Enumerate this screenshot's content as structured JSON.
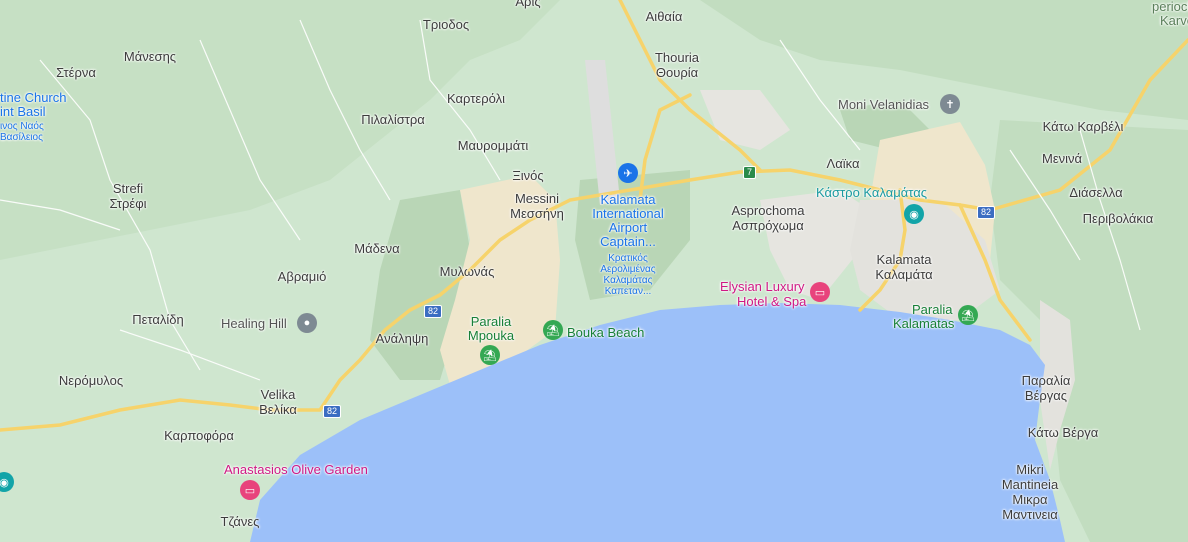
{
  "map": {
    "places": [
      {
        "id": "aris",
        "text": "Αρις"
      },
      {
        "id": "aithaia",
        "text": "Αιθαία"
      },
      {
        "id": "triodos",
        "text": "Τριοδος"
      },
      {
        "id": "sterna",
        "text": "Στέρνα"
      },
      {
        "id": "manesis",
        "text": "Μάνεσης"
      },
      {
        "id": "thouria_en",
        "text": "Thouria"
      },
      {
        "id": "thouria_gr",
        "text": "Θουρία"
      },
      {
        "id": "karterоli",
        "text": "Καρτερόλι"
      },
      {
        "id": "pilalistra",
        "text": "Πιλαλίστρα"
      },
      {
        "id": "mavrommati",
        "text": "Μαυρομμάτι"
      },
      {
        "id": "xinos",
        "text": "Ξινός"
      },
      {
        "id": "messini_en",
        "text": "Messini"
      },
      {
        "id": "messini_gr",
        "text": "Μεσσήνη"
      },
      {
        "id": "strefi_en",
        "text": "Strefi"
      },
      {
        "id": "strefi_gr",
        "text": "Στρέφι"
      },
      {
        "id": "madena",
        "text": "Μάδενα"
      },
      {
        "id": "avramio",
        "text": "Αβραμιό"
      },
      {
        "id": "mylonas",
        "text": "Μυλωνάς"
      },
      {
        "id": "petalidi",
        "text": "Πεταλίδη"
      },
      {
        "id": "analipsi",
        "text": "Ανάληψη"
      },
      {
        "id": "neromylos",
        "text": "Νερόμυλος"
      },
      {
        "id": "velika_en",
        "text": "Velika"
      },
      {
        "id": "velika_gr",
        "text": "Βελίκα"
      },
      {
        "id": "karpofora",
        "text": "Καρποφόρα"
      },
      {
        "id": "tzanes",
        "text": "Τζάνες"
      },
      {
        "id": "aspro_en",
        "text": "Asprochoma"
      },
      {
        "id": "aspro_gr",
        "text": "Ασπρόχωμα"
      },
      {
        "id": "laika",
        "text": "Λαϊκα"
      },
      {
        "id": "kalamata_en",
        "text": "Kalamata"
      },
      {
        "id": "kalamata_gr",
        "text": "Καλαμάτα"
      },
      {
        "id": "kato_karveli",
        "text": "Κάτω Καρβέλι"
      },
      {
        "id": "menina",
        "text": "Μενινά"
      },
      {
        "id": "diasella",
        "text": "Διάσελλα"
      },
      {
        "id": "perivolakia",
        "text": "Περιβολάκια"
      },
      {
        "id": "paralia_vergas_1",
        "text": "Παραλία"
      },
      {
        "id": "paralia_vergas_2",
        "text": "Βέργας"
      },
      {
        "id": "kato_verga",
        "text": "Κάτω Βέργα"
      },
      {
        "id": "mikri_1",
        "text": "Mikri"
      },
      {
        "id": "mikri_2",
        "text": "Mantineia"
      },
      {
        "id": "mikri_3",
        "text": "Μικρα"
      },
      {
        "id": "mikri_4",
        "text": "Μαντινεια"
      },
      {
        "id": "perioch",
        "text": "periochi"
      },
      {
        "id": "karve",
        "text": "Karve"
      }
    ],
    "pois": {
      "church_1": "tine Church",
      "church_2": "int Basil",
      "church_3": "ινος Ναός",
      "church_4": "Βασίλειος",
      "airport_1": "Kalamata",
      "airport_2": "International",
      "airport_3": "Airport",
      "airport_4": "Captain...",
      "airport_gr_1": "Κρατικός",
      "airport_gr_2": "Αερολιμένας",
      "airport_gr_3": "Καλαμάτας",
      "airport_gr_4": "Καπεταν...",
      "moni": "Moni Velanidias",
      "kastro": "Κάστρο Καλαμάτας",
      "elysian_1": "Elysian Luxury",
      "elysian_2": "Hotel & Spa",
      "paralia_kal_1": "Paralia",
      "paralia_kal_2": "Kalamatas",
      "paralia_mp_1": "Paralia",
      "paralia_mp_2": "Μpouka",
      "bouka": "Bouka Beach",
      "healing": "Healing Hill",
      "olive": "Anastasios Olive Garden"
    },
    "shields": {
      "r82a": "82",
      "r82b": "82",
      "r82c": "82",
      "r7": "7"
    },
    "colors": {
      "land": "#cfe6cf",
      "sea": "#9cc0f9",
      "urban": "#e9e8e2",
      "sand": "#f0e6cc",
      "road": "#f6d36b",
      "forest": "#b9d6b6"
    }
  }
}
